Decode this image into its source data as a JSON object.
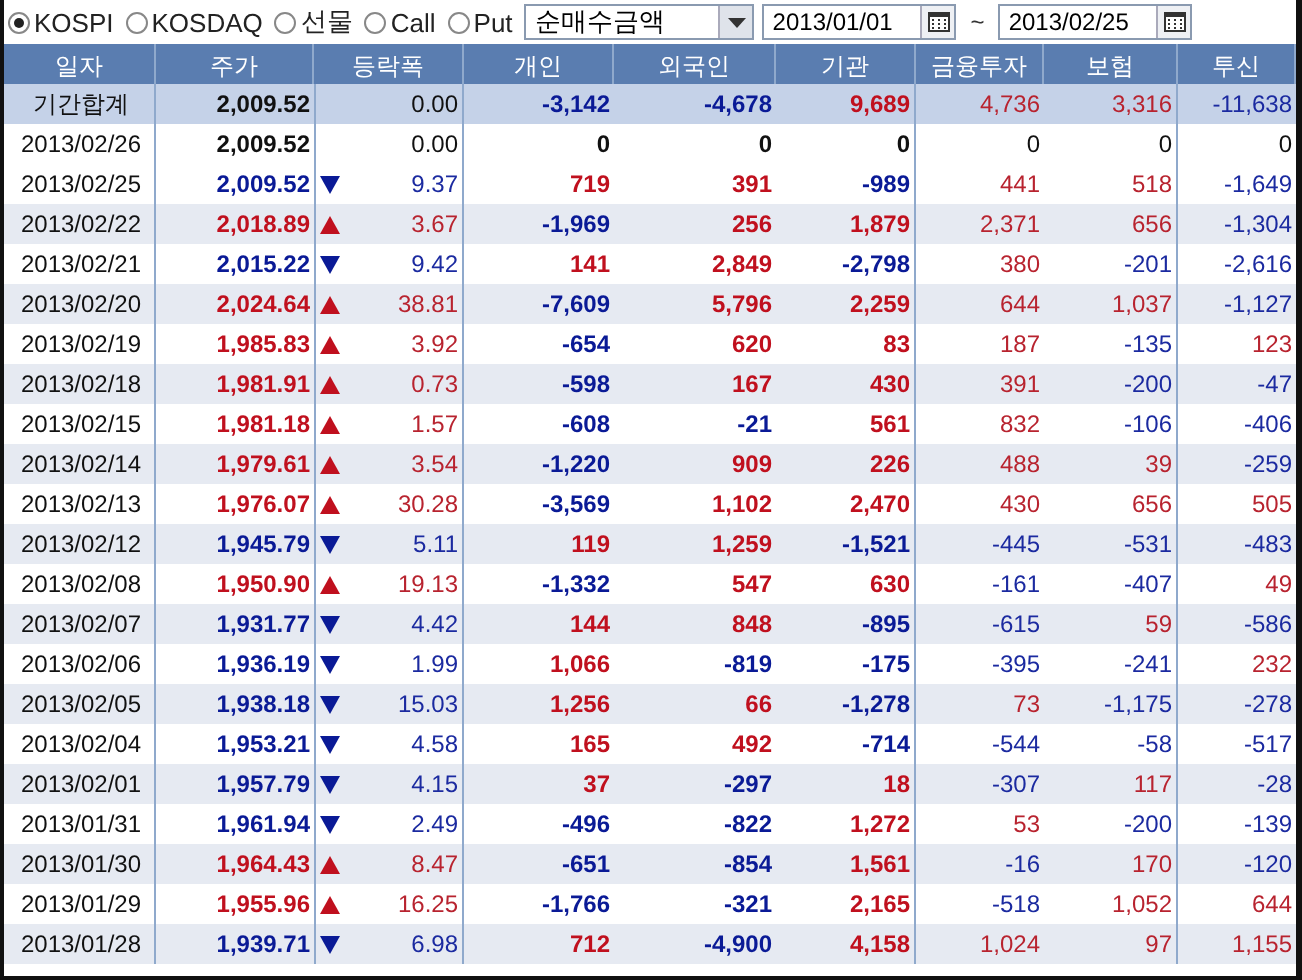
{
  "toolbar": {
    "markets": [
      {
        "label": "KOSPI",
        "selected": true
      },
      {
        "label": "KOSDAQ",
        "selected": false
      },
      {
        "label": "선물",
        "selected": false
      },
      {
        "label": "Call",
        "selected": false
      },
      {
        "label": "Put",
        "selected": false
      }
    ],
    "mode": "순매수금액",
    "date_from": "2013/01/01",
    "separator": "~",
    "date_to": "2013/02/25"
  },
  "table": {
    "columns": [
      "일자",
      "주가",
      "등락폭",
      "개인",
      "외국인",
      "기관",
      "금융투자",
      "보험",
      "투신"
    ],
    "rows": [
      {
        "kind": "total",
        "date": "기간합계",
        "price": "2,009.52",
        "change": "0.00",
        "values": [
          "-3,142",
          "-4,678",
          "9,689",
          "4,736",
          "3,316",
          "-11,638"
        ]
      },
      {
        "kind": "flat",
        "date": "2013/02/26",
        "price": "2,009.52",
        "change": "0.00",
        "values": [
          "0",
          "0",
          "0",
          "0",
          "0",
          "0"
        ]
      },
      {
        "kind": "down",
        "date": "2013/02/25",
        "price": "2,009.52",
        "change": "9.37",
        "values": [
          "719",
          "391",
          "-989",
          "441",
          "518",
          "-1,649"
        ]
      },
      {
        "kind": "up",
        "date": "2013/02/22",
        "price": "2,018.89",
        "change": "3.67",
        "values": [
          "-1,969",
          "256",
          "1,879",
          "2,371",
          "656",
          "-1,304"
        ]
      },
      {
        "kind": "down",
        "date": "2013/02/21",
        "price": "2,015.22",
        "change": "9.42",
        "values": [
          "141",
          "2,849",
          "-2,798",
          "380",
          "-201",
          "-2,616"
        ]
      },
      {
        "kind": "up",
        "date": "2013/02/20",
        "price": "2,024.64",
        "change": "38.81",
        "values": [
          "-7,609",
          "5,796",
          "2,259",
          "644",
          "1,037",
          "-1,127"
        ]
      },
      {
        "kind": "up",
        "date": "2013/02/19",
        "price": "1,985.83",
        "change": "3.92",
        "values": [
          "-654",
          "620",
          "83",
          "187",
          "-135",
          "123"
        ]
      },
      {
        "kind": "up",
        "date": "2013/02/18",
        "price": "1,981.91",
        "change": "0.73",
        "values": [
          "-598",
          "167",
          "430",
          "391",
          "-200",
          "-47"
        ]
      },
      {
        "kind": "up",
        "date": "2013/02/15",
        "price": "1,981.18",
        "change": "1.57",
        "values": [
          "-608",
          "-21",
          "561",
          "832",
          "-106",
          "-406"
        ]
      },
      {
        "kind": "up",
        "date": "2013/02/14",
        "price": "1,979.61",
        "change": "3.54",
        "values": [
          "-1,220",
          "909",
          "226",
          "488",
          "39",
          "-259"
        ]
      },
      {
        "kind": "up",
        "date": "2013/02/13",
        "price": "1,976.07",
        "change": "30.28",
        "values": [
          "-3,569",
          "1,102",
          "2,470",
          "430",
          "656",
          "505"
        ]
      },
      {
        "kind": "down",
        "date": "2013/02/12",
        "price": "1,945.79",
        "change": "5.11",
        "values": [
          "119",
          "1,259",
          "-1,521",
          "-445",
          "-531",
          "-483"
        ]
      },
      {
        "kind": "up",
        "date": "2013/02/08",
        "price": "1,950.90",
        "change": "19.13",
        "values": [
          "-1,332",
          "547",
          "630",
          "-161",
          "-407",
          "49"
        ]
      },
      {
        "kind": "down",
        "date": "2013/02/07",
        "price": "1,931.77",
        "change": "4.42",
        "values": [
          "144",
          "848",
          "-895",
          "-615",
          "59",
          "-586"
        ]
      },
      {
        "kind": "down",
        "date": "2013/02/06",
        "price": "1,936.19",
        "change": "1.99",
        "values": [
          "1,066",
          "-819",
          "-175",
          "-395",
          "-241",
          "232"
        ]
      },
      {
        "kind": "down",
        "date": "2013/02/05",
        "price": "1,938.18",
        "change": "15.03",
        "values": [
          "1,256",
          "66",
          "-1,278",
          "73",
          "-1,175",
          "-278"
        ]
      },
      {
        "kind": "down",
        "date": "2013/02/04",
        "price": "1,953.21",
        "change": "4.58",
        "values": [
          "165",
          "492",
          "-714",
          "-544",
          "-58",
          "-517"
        ]
      },
      {
        "kind": "down",
        "date": "2013/02/01",
        "price": "1,957.79",
        "change": "4.15",
        "values": [
          "37",
          "-297",
          "18",
          "-307",
          "117",
          "-28"
        ]
      },
      {
        "kind": "down",
        "date": "2013/01/31",
        "price": "1,961.94",
        "change": "2.49",
        "values": [
          "-496",
          "-822",
          "1,272",
          "53",
          "-200",
          "-139"
        ]
      },
      {
        "kind": "up",
        "date": "2013/01/30",
        "price": "1,964.43",
        "change": "8.47",
        "values": [
          "-651",
          "-854",
          "1,561",
          "-16",
          "170",
          "-120"
        ]
      },
      {
        "kind": "up",
        "date": "2013/01/29",
        "price": "1,955.96",
        "change": "16.25",
        "values": [
          "-1,766",
          "-321",
          "2,165",
          "-518",
          "1,052",
          "644"
        ]
      },
      {
        "kind": "down",
        "date": "2013/01/28",
        "price": "1,939.71",
        "change": "6.98",
        "values": [
          "712",
          "-4,900",
          "4,158",
          "1,024",
          "97",
          "1,155"
        ]
      }
    ]
  }
}
